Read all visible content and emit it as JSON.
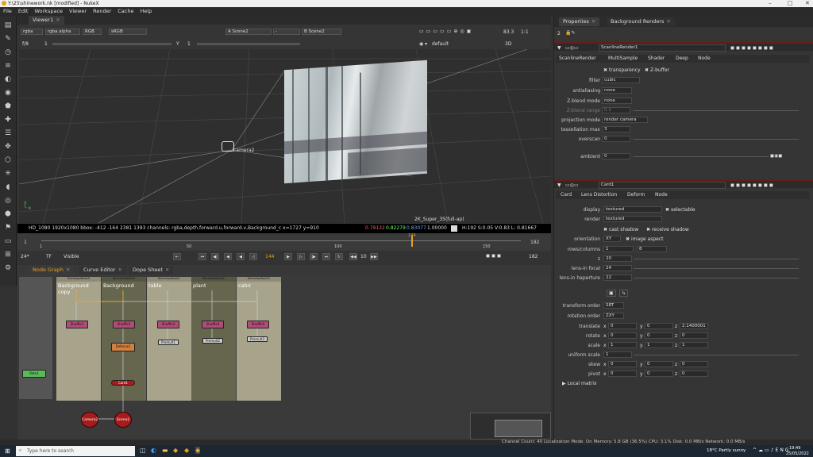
{
  "window": {
    "title": "Y:\\25\\shinework.nk [modified] - NukeX"
  },
  "menu": [
    "File",
    "Edit",
    "Workspace",
    "Viewer",
    "Render",
    "Cache",
    "Help"
  ],
  "viewer": {
    "tab": "Viewer1",
    "channels": "rgba",
    "alpha": "rgba.alpha",
    "colorspace_mode": "RGB",
    "lut": "sRGB",
    "input_a": "A  Scene2",
    "a_op": "-",
    "input_b": "B  Scene2",
    "zoom": "83.3",
    "ratio": "1:1",
    "fstop": "f/8",
    "frame_step": "1",
    "gamma_label": "Y",
    "gamma_val": "1",
    "display_mode": "default",
    "view_mode": "3D",
    "camera_label": "camera2",
    "format_label": "2K_Super_35(full-ap)",
    "info": "HD_1080 1920x1080  bbox: -412 -164 2381 1393 channels: rgba,depth,forward.u,forward.v,Background_c  x=1727 y=910",
    "pixel_r": "0.79132",
    "pixel_g": "0.82279",
    "pixel_b": "0.83077",
    "pixel_a": "1.00000",
    "hsv": "H:192 S:0.05 V:0.83  L: 0.81667"
  },
  "timeline": {
    "ticks": [
      "1",
      "50",
      "100",
      "150",
      "182"
    ],
    "start": "1",
    "end": "182",
    "fps": "24*",
    "tf": "TF",
    "visible": "Visible",
    "current_frame": "144",
    "step": "10",
    "end_frame": "182",
    "marker": "144"
  },
  "node_graph": {
    "tabs": [
      "Node Graph",
      "Curve Editor",
      "Dope Sheet"
    ],
    "backdrops": [
      "Background copy",
      "Background",
      "table",
      "plant",
      "cahir"
    ],
    "bd_titles": [
      "BackdropNode5",
      "BackdropNode4",
      "BackdropNode1",
      "BackdropNode2",
      "BackdropNode3"
    ],
    "nodes": {
      "shuffle1": "Shuffle1",
      "shuffle2": "Shuffle2",
      "shuffle3": "Shuffle3",
      "shuffle4": "Shuffle4",
      "shuffle5": "Shuffle5",
      "defocus": "Defocus1",
      "premult1": "Premult1",
      "premult2": "Premult2",
      "premult3": "Premult3",
      "card": "Card1",
      "roto": "Roto1",
      "camera": "Camera2",
      "scene": "Scene2",
      "scanline": "ScanlineRender1"
    }
  },
  "properties": {
    "tabs": [
      "Properties",
      "Background Renders"
    ],
    "max_panels": "2",
    "scanline": {
      "name": "ScanlineRender1",
      "tabs": [
        "ScanlineRender",
        "MultiSample",
        "Shader",
        "Deep",
        "Node"
      ],
      "transparency": "transparency",
      "zbuffer": "Z-buffer",
      "filter": {
        "label": "filter",
        "value": "cubic"
      },
      "antialiasing": {
        "label": "antialiasing",
        "value": "none"
      },
      "zblend_mode": {
        "label": "Z-blend mode",
        "value": "none"
      },
      "zblend_range": {
        "label": "Z-blend range",
        "value": "0.1"
      },
      "projection": {
        "label": "projection mode",
        "value": "render camera"
      },
      "tess": {
        "label": "tessellation max",
        "value": "3"
      },
      "overscan": {
        "label": "overscan",
        "value": "0"
      },
      "ambient": {
        "label": "ambient",
        "value": "0"
      }
    },
    "card": {
      "name": "Card1",
      "tabs": [
        "Card",
        "Lens Distortion",
        "Deform",
        "Node"
      ],
      "display": {
        "label": "display",
        "value": "textured"
      },
      "selectable": "selectable",
      "render": {
        "label": "render",
        "value": "textured"
      },
      "cast_shadow": "cast shadow",
      "receive_shadow": "receive shadow",
      "orientation": {
        "label": "orientation",
        "value": "XY"
      },
      "image_aspect": "image aspect",
      "rows_columns": {
        "label": "rows/columns",
        "v1": "1",
        "v2": "8"
      },
      "z": {
        "label": "z",
        "value": "20"
      },
      "lens_focal": {
        "label": "lens-in focal",
        "value": "24"
      },
      "lens_haperture": {
        "label": "lens-in haperture",
        "value": "22"
      },
      "transform_order": {
        "label": "transform order",
        "value": "SRT"
      },
      "rotation_order": {
        "label": "rotation order",
        "value": "ZXY"
      },
      "translate": {
        "label": "translate",
        "x": "0",
        "y": "0",
        "z": "2.1400001"
      },
      "rotate": {
        "label": "rotate",
        "x": "0",
        "y": "0",
        "z": "0"
      },
      "scale": {
        "label": "scale",
        "x": "1",
        "y": "1",
        "z": "1"
      },
      "uniform_scale": {
        "label": "uniform scale",
        "value": "1"
      },
      "skew": {
        "label": "skew",
        "x": "0",
        "y": "0",
        "z": "0"
      },
      "pivot": {
        "label": "pivot",
        "x": "0",
        "y": "0",
        "z": "0"
      },
      "local_matrix": "Local matrix"
    }
  },
  "status": {
    "text": "Channel Count: 40 Localization Mode: On Memory: 5.8 GB (36.5%) CPU: 3.1% Disk: 0.0 MB/s Network: 0.0 MB/s"
  },
  "taskbar": {
    "search_placeholder": "Type here to search",
    "weather": "18°C  Partly sunny",
    "time": "19:49",
    "date": "25/05/2022"
  }
}
